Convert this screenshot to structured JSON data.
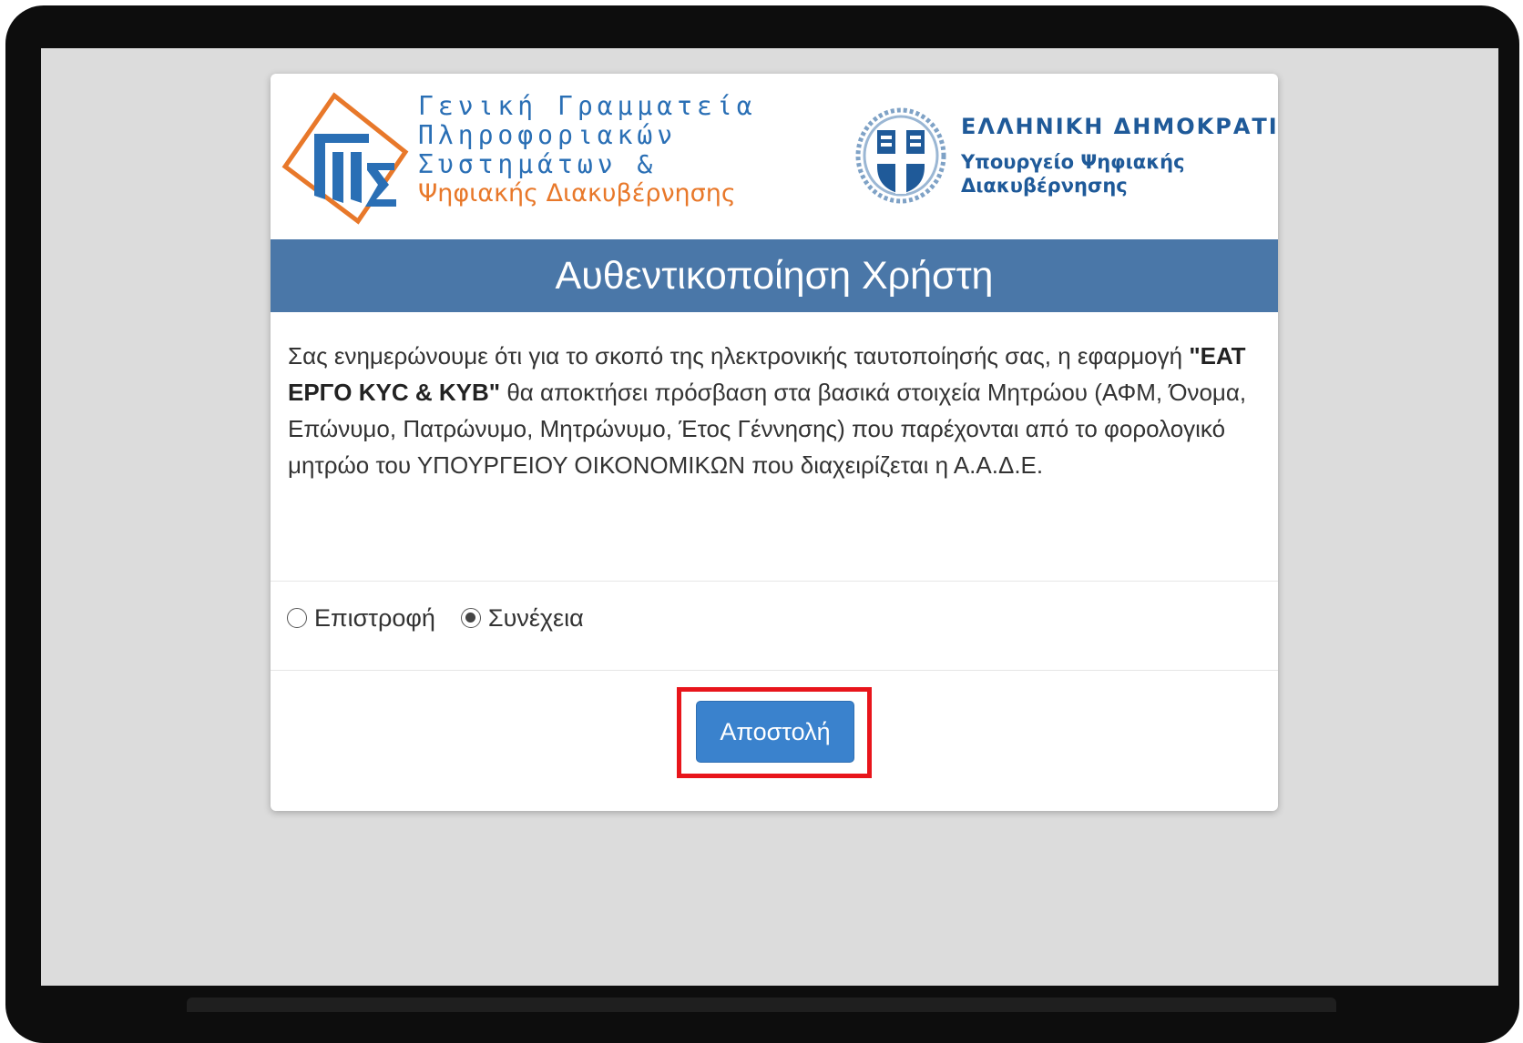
{
  "logos": {
    "gsis_lines": [
      "Γενική Γραμματεία",
      "Πληροφοριακών",
      "Συστημάτων &"
    ],
    "gsis_line_orange": "Ψηφιακής Διακυβέρνησης",
    "republic_title": "ΕΛΛΗΝΙΚΗ ΔΗΜΟΚΡΑΤΙΑ",
    "ministry_lines": [
      "Υπουργείο Ψηφιακής",
      "Διακυβέρνησης"
    ]
  },
  "header": {
    "title": "Αυθεντικοποίηση Χρήστη"
  },
  "info": {
    "text_before": "Σας ενημερώνουμε ότι για το σκοπό της ηλεκτρονικής ταυτοποίησής σας, η εφαρμογή ",
    "app_name": "\"ΕΑΤ ΕΡΓΟ KYC & KYB\"",
    "text_after": " θα αποκτήσει πρόσβαση στα βασικά στοιχεία Μητρώου (ΑΦΜ, Όνομα, Επώνυμο, Πατρώνυμο, Μητρώνυμο, Έτος Γέννησης) που παρέχονται από το φορολογικό μητρώο του ΥΠΟΥΡΓΕΙΟΥ ΟΙΚΟΝΟΜΙΚΩΝ που διαχειρίζεται η Α.Α.Δ.Ε."
  },
  "radio": {
    "options": [
      {
        "label": "Επιστροφή",
        "checked": false
      },
      {
        "label": "Συνέχεια",
        "checked": true
      }
    ]
  },
  "actions": {
    "submit_label": "Αποστολή"
  },
  "colors": {
    "header_band": "#4a77a8",
    "button": "#3a82cd",
    "highlight": "#e8151b",
    "gsis_blue": "#2a6fb5",
    "gsis_orange": "#e8782a"
  }
}
